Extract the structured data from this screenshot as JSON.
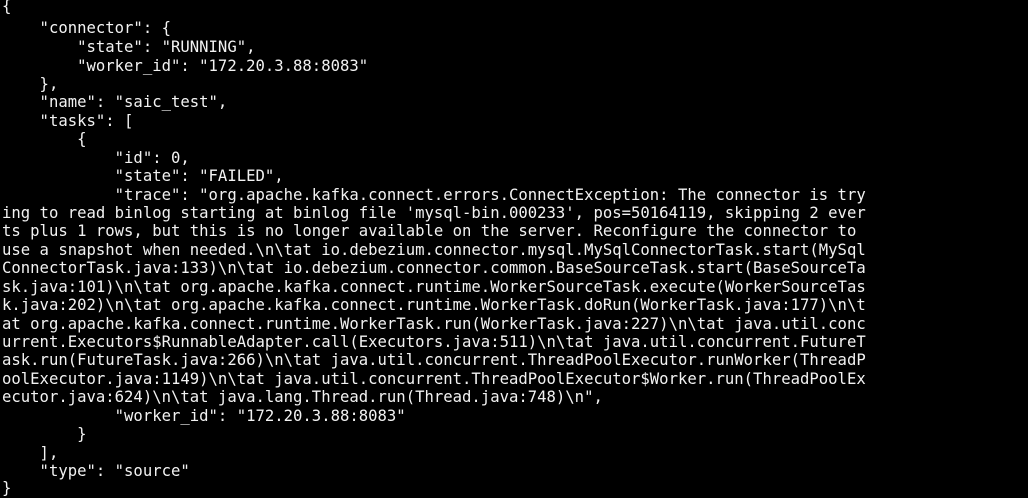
{
  "terminal": {
    "background": "#000000",
    "foreground": "#f2f2f2",
    "lines": [
      "{",
      "    \"connector\": {",
      "        \"state\": \"RUNNING\",",
      "        \"worker_id\": \"172.20.3.88:8083\"",
      "    },",
      "    \"name\": \"saic_test\",",
      "    \"tasks\": [",
      "        {",
      "            \"id\": 0,",
      "            \"state\": \"FAILED\",",
      "            \"trace\": \"org.apache.kafka.connect.errors.ConnectException: The connector is try",
      "ing to read binlog starting at binlog file 'mysql-bin.000233', pos=50164119, skipping 2 ever",
      "ts plus 1 rows, but this is no longer available on the server. Reconfigure the connector to",
      "use a snapshot when needed.\\n\\tat io.debezium.connector.mysql.MySqlConnectorTask.start(MySql",
      "ConnectorTask.java:133)\\n\\tat io.debezium.connector.common.BaseSourceTask.start(BaseSourceTa",
      "sk.java:101)\\n\\tat org.apache.kafka.connect.runtime.WorkerSourceTask.execute(WorkerSourceTas",
      "k.java:202)\\n\\tat org.apache.kafka.connect.runtime.WorkerTask.doRun(WorkerTask.java:177)\\n\\t",
      "at org.apache.kafka.connect.runtime.WorkerTask.run(WorkerTask.java:227)\\n\\tat java.util.conc",
      "urrent.Executors$RunnableAdapter.call(Executors.java:511)\\n\\tat java.util.concurrent.FutureT",
      "ask.run(FutureTask.java:266)\\n\\tat java.util.concurrent.ThreadPoolExecutor.runWorker(ThreadP",
      "oolExecutor.java:1149)\\n\\tat java.util.concurrent.ThreadPoolExecutor$Worker.run(ThreadPoolEx",
      "ecutor.java:624)\\n\\tat java.lang.Thread.run(Thread.java:748)\\n\",",
      "            \"worker_id\": \"172.20.3.88:8083\"",
      "        }",
      "    ],",
      "    \"type\": \"source\"",
      "}"
    ]
  }
}
